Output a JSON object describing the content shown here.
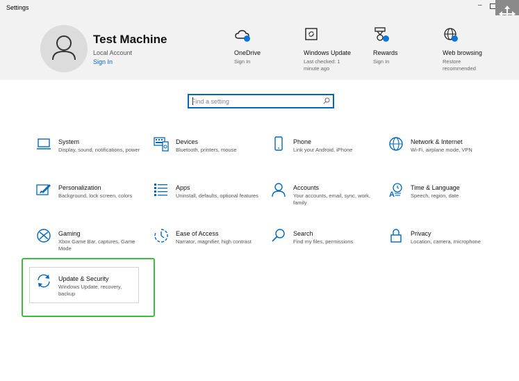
{
  "window": {
    "title": "Settings"
  },
  "user": {
    "name": "Test Machine",
    "account_type": "Local Account",
    "sign_in": "Sign In"
  },
  "header_items": [
    {
      "label": "OneDrive",
      "sub": "Sign In",
      "icon": "cloud-icon"
    },
    {
      "label": "Windows Update",
      "sub": "Last checked: 1 minute ago",
      "icon": "update-icon"
    },
    {
      "label": "Rewards",
      "sub": "Sign In",
      "icon": "rewards-icon"
    },
    {
      "label": "Web browsing",
      "sub": "Restore recommended",
      "icon": "globe-icon"
    }
  ],
  "search": {
    "placeholder": "Find a setting"
  },
  "categories": [
    {
      "title": "System",
      "desc": "Display, sound, notifications, power",
      "icon": "laptop-icon"
    },
    {
      "title": "Devices",
      "desc": "Bluetooth, printers, mouse",
      "icon": "keyboard-icon"
    },
    {
      "title": "Phone",
      "desc": "Link your Android, iPhone",
      "icon": "phone-icon"
    },
    {
      "title": "Network & Internet",
      "desc": "Wi-Fi, airplane mode, VPN",
      "icon": "globe-icon"
    },
    {
      "title": "Personalization",
      "desc": "Background, lock screen, colors",
      "icon": "paint-icon"
    },
    {
      "title": "Apps",
      "desc": "Uninstall, defaults, optional features",
      "icon": "apps-list-icon"
    },
    {
      "title": "Accounts",
      "desc": "Your accounts, email, sync, work, family",
      "icon": "person-icon"
    },
    {
      "title": "Time & Language",
      "desc": "Speech, region, date",
      "icon": "time-language-icon"
    },
    {
      "title": "Gaming",
      "desc": "Xbox Game Bar, captures, Game Mode",
      "icon": "xbox-icon"
    },
    {
      "title": "Ease of Access",
      "desc": "Narrator, magnifier, high contrast",
      "icon": "ease-of-access-icon"
    },
    {
      "title": "Search",
      "desc": "Find my files, permissions",
      "icon": "magnifier-icon"
    },
    {
      "title": "Privacy",
      "desc": "Location, camera, microphone",
      "icon": "lock-icon"
    },
    {
      "title": "Update & Security",
      "desc": "Windows Update, recovery, backup",
      "icon": "sync-icon"
    }
  ],
  "colors": {
    "accent": "#0067c0",
    "highlight": "#3dbb3d",
    "header_bg": "#f2f2f2"
  }
}
